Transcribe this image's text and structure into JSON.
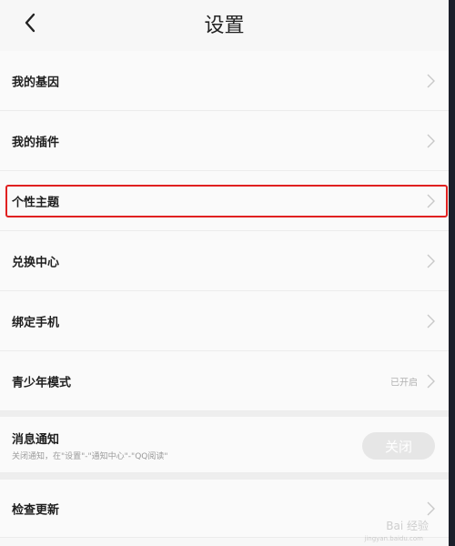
{
  "header": {
    "title": "设置",
    "back_icon": "chevron-left-icon"
  },
  "rows": [
    {
      "label": "我的基因"
    },
    {
      "label": "我的插件"
    },
    {
      "label": "个性主题"
    },
    {
      "label": "兑换中心"
    },
    {
      "label": "绑定手机"
    },
    {
      "label": "青少年模式",
      "status": "已开启"
    }
  ],
  "notification": {
    "label": "消息通知",
    "subtitle": "关闭通知，在\"设置\"-\"通知中心\"-\"QQ阅读\"",
    "toggle_label": "关闭"
  },
  "update": {
    "label": "检查更新"
  },
  "watermark": {
    "text": "Bai 经验",
    "sub": "jingyan.baidu.com"
  },
  "colors": {
    "highlight": "#e02020",
    "toggle_bg": "#e6e6e6",
    "chevron": "#c8c8c8"
  }
}
